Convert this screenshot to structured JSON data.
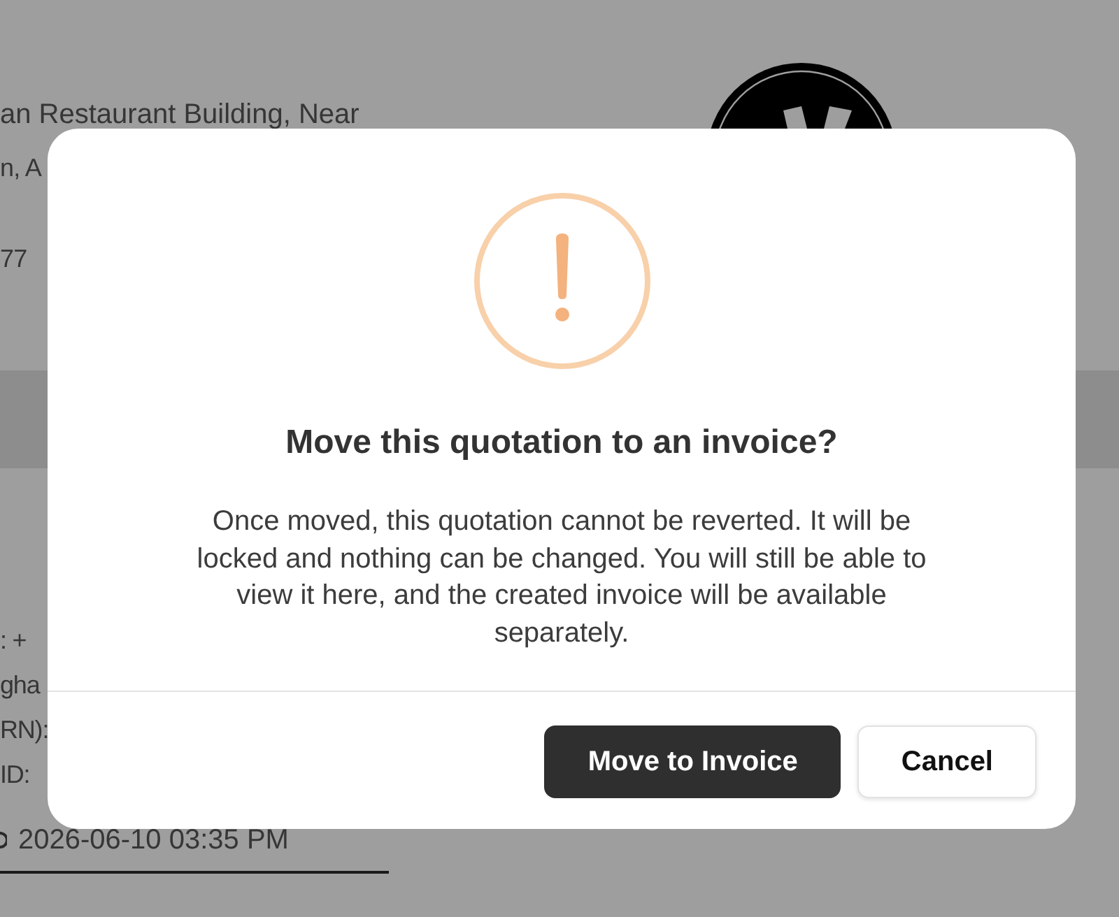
{
  "page": {
    "address_lines": [
      "an Restaurant Building, Near",
      "n, A",
      "77"
    ],
    "detail_lines": [
      ": +",
      "gha",
      "RN):",
      "ID:"
    ],
    "date": "2026-06-10 03:35 PM"
  },
  "dialog": {
    "title": "Move this quotation to an invoice?",
    "message": "Once moved, this quotation cannot be reverted. It will be locked and nothing can be changed. You will still be able to view it here, and the created invoice will be available separately.",
    "buttons": [
      {
        "label": "Move to Invoice",
        "kind": "primary"
      },
      {
        "label": "Cancel",
        "kind": "secondary"
      }
    ]
  }
}
